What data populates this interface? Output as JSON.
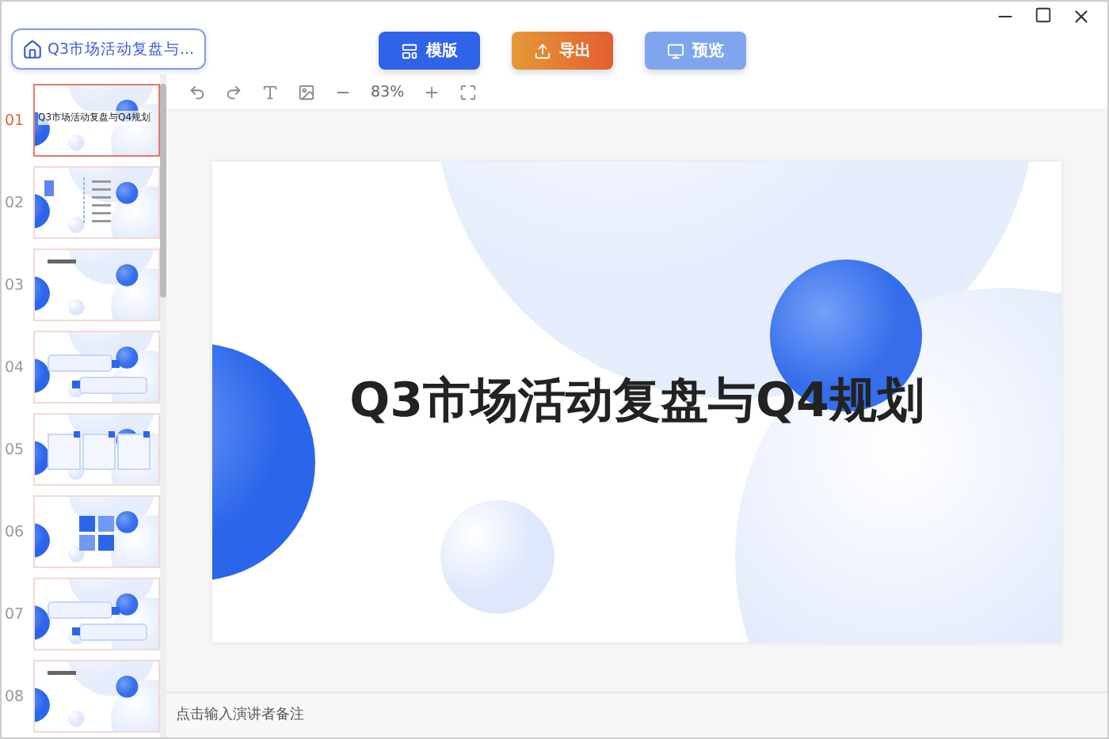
{
  "header": {
    "home_label": "Q3市场活动复盘与...",
    "actions": [
      {
        "kind": "template",
        "label": "模版"
      },
      {
        "kind": "export",
        "label": "导出"
      },
      {
        "kind": "preview",
        "label": "预览"
      }
    ]
  },
  "toolbar": {
    "zoom": "83%"
  },
  "slides": [
    {
      "number": "01",
      "kind": "cover",
      "selected": true,
      "title": "Q3市场活动复盘与Q4规划"
    },
    {
      "number": "02",
      "kind": "agenda",
      "selected": false
    },
    {
      "number": "03",
      "kind": "section",
      "selected": false
    },
    {
      "number": "04",
      "kind": "callouts",
      "selected": false
    },
    {
      "number": "05",
      "kind": "columns",
      "selected": false
    },
    {
      "number": "06",
      "kind": "grid",
      "selected": false
    },
    {
      "number": "07",
      "kind": "callouts",
      "selected": false
    },
    {
      "number": "08",
      "kind": "section",
      "selected": false
    }
  ],
  "canvas": {
    "title": "Q3市场活动复盘与Q4规划"
  },
  "notes": {
    "placeholder": "点击输入演讲者备注"
  }
}
